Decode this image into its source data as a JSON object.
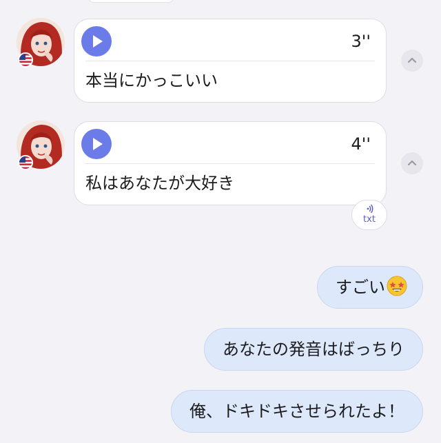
{
  "messages_received": [
    {
      "duration": "3''",
      "transcript": "本当にかっこいい"
    },
    {
      "duration": "4''",
      "transcript": "私はあなたが大好き"
    }
  ],
  "txt_button": {
    "label": "txt"
  },
  "messages_sent": [
    {
      "text": "すごい"
    },
    {
      "text": "あなたの発音はばっちり"
    },
    {
      "text": "俺、ドキドキさせられたよ！"
    }
  ],
  "colors": {
    "background": "#f2f2f7",
    "play_button": "#6b7ce8",
    "sent_bubble": "#dde9fb",
    "accent_text": "#5b5fc7"
  },
  "icons": {
    "play": "play-icon",
    "collapse": "chevron-up-icon",
    "flag": "us-flag-icon",
    "transcribe": "sound-wave-icon",
    "emoji": "star-struck-emoji"
  }
}
